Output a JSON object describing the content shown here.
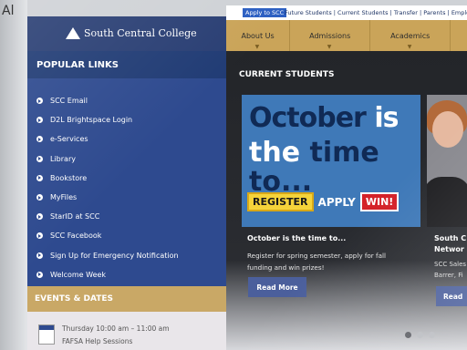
{
  "outside": {
    "fragment": "Al"
  },
  "utility_bar": {
    "apply_label": "Apply to SCC",
    "links_text": "Future Students | Current Students | Transfer | Parents | Employees"
  },
  "header": {
    "logo_text": "South Central College"
  },
  "nav": {
    "items": [
      "About Us",
      "Admissions",
      "Academics"
    ]
  },
  "sidebar": {
    "title": "POPULAR LINKS",
    "links": [
      "SCC Email",
      "D2L Brightspace Login",
      "e-Services",
      "Library",
      "Bookstore",
      "MyFiles",
      "StarID at SCC",
      "SCC Facebook",
      "Sign Up for Emergency Notification",
      "Welcome Week"
    ],
    "events_title": "EVENTS & DATES",
    "event": {
      "time": "Thursday 10:00 am – 11:00 am",
      "title": "FAFSA Help Sessions"
    }
  },
  "main": {
    "section_title": "CURRENT STUDENTS",
    "card1": {
      "promo_line1_a": "October",
      "promo_line1_b": "is",
      "promo_line2_a": "the",
      "promo_line2_b": "time to...",
      "promo_register": "REGISTER",
      "promo_apply": "APPLY",
      "promo_win": "WIN!",
      "heading": "October is the time to...",
      "desc_line1": "Register for spring semester, apply for fall",
      "desc_line2": "funding and win prizes!",
      "button": "Read More"
    },
    "card2": {
      "heading_line1": "South C",
      "heading_line2": "Networ",
      "desc_line1": "SCC Sales",
      "desc_line2": "Barrer, Fi",
      "button": "Read"
    }
  }
}
